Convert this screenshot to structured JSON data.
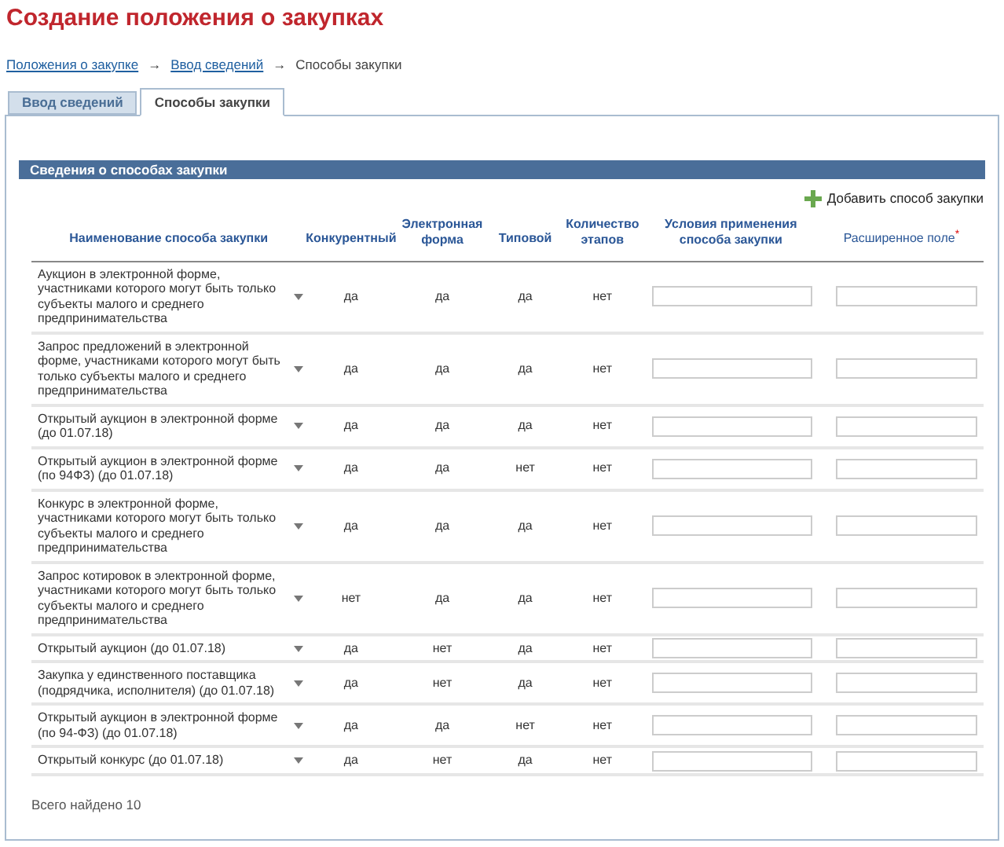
{
  "page_title": "Создание положения о закупках",
  "breadcrumbs": [
    {
      "label": "Положения о закупке",
      "link": true
    },
    {
      "label": "Ввод сведений",
      "link": true
    },
    {
      "label": "Способы закупки",
      "link": false
    }
  ],
  "breadcrumb_separator": "→",
  "tabs": [
    {
      "label": "Ввод сведений",
      "selected": false
    },
    {
      "label": "Способы закупки",
      "selected": true
    }
  ],
  "section_title": "Сведения о способах закупки",
  "add_button": "Добавить способ закупки",
  "table": {
    "columns": [
      {
        "label": "Наименование способа закупки"
      },
      {
        "label": "Конкурентный"
      },
      {
        "label": "Электронная форма"
      },
      {
        "label": "Типовой"
      },
      {
        "label": "Количество этапов"
      },
      {
        "label": "Условия применения способа закупки"
      },
      {
        "label": "Расширенное поле",
        "required_mark": "*"
      }
    ],
    "rows": [
      {
        "name": "Аукцион в электронной форме, участниками которого могут быть только субъекты малого и среднего предпринимательства",
        "competitive": "да",
        "electronic": "да",
        "typical": "да",
        "stages": "нет"
      },
      {
        "name": "Запрос предложений в электронной форме, участниками которого могут быть только субъекты малого и среднего предпринимательства",
        "competitive": "да",
        "electronic": "да",
        "typical": "да",
        "stages": "нет"
      },
      {
        "name": "Открытый аукцион в электронной форме (до 01.07.18)",
        "competitive": "да",
        "electronic": "да",
        "typical": "да",
        "stages": "нет"
      },
      {
        "name": "Открытый аукцион в электронной форме (по 94ФЗ) (до 01.07.18)",
        "competitive": "да",
        "electronic": "да",
        "typical": "нет",
        "stages": "нет"
      },
      {
        "name": "Конкурс в электронной форме, участниками которого могут быть только субъекты малого и среднего предпринимательства",
        "competitive": "да",
        "electronic": "да",
        "typical": "да",
        "stages": "нет"
      },
      {
        "name": "Запрос котировок в электронной форме, участниками которого могут быть только субъекты малого и среднего предпринимательства",
        "competitive": "нет",
        "electronic": "да",
        "typical": "да",
        "stages": "нет"
      },
      {
        "name": "Открытый аукцион (до 01.07.18)",
        "competitive": "да",
        "electronic": "нет",
        "typical": "да",
        "stages": "нет"
      },
      {
        "name": "Закупка у единственного поставщика (подрядчика, исполнителя) (до 01.07.18)",
        "competitive": "да",
        "electronic": "нет",
        "typical": "да",
        "stages": "нет"
      },
      {
        "name": "Открытый аукцион в электронной форме (по 94-ФЗ) (до 01.07.18)",
        "competitive": "да",
        "electronic": "да",
        "typical": "нет",
        "stages": "нет"
      },
      {
        "name": "Открытый конкурс (до 01.07.18)",
        "competitive": "да",
        "electronic": "нет",
        "typical": "да",
        "stages": "нет"
      }
    ]
  },
  "total": "Всего найдено 10"
}
